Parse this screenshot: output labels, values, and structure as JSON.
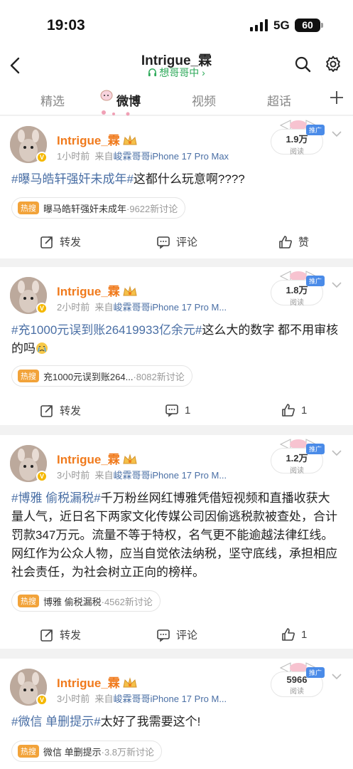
{
  "status": {
    "time": "19:03",
    "network": "5G",
    "battery": "60"
  },
  "header": {
    "title": "Intrigue_霖",
    "subtitle": "想哥哥中",
    "subtitle_arrow": "›"
  },
  "tabs": [
    {
      "label": "精选"
    },
    {
      "label": "微博"
    },
    {
      "label": "视频"
    },
    {
      "label": "超话"
    }
  ],
  "posts": [
    {
      "author": "Intrigue_霖",
      "time": "1小时前",
      "from_prefix": "来自",
      "source": "峻霖哥哥iPhone 17 Pro Max",
      "promo": "推广",
      "reads": "1.9万",
      "reads_label": "阅读",
      "tag": "#曝马皓轩强奸未成年#",
      "text": "这都什么玩意啊????",
      "hot_label": "热搜",
      "hot_topic": "曝马皓轩强奸未成年",
      "hot_count": "·9622新讨论",
      "repost": "转发",
      "comment": "评论",
      "like": "赞"
    },
    {
      "author": "Intrigue_霖",
      "time": "2小时前",
      "from_prefix": "来自",
      "source": "峻霖哥哥iPhone 17 Pro M...",
      "promo": "推广",
      "reads": "1.8万",
      "reads_label": "阅读",
      "tag": "#充1000元误到账26419933亿余元#",
      "text": "这么大的数字 都不用审核的吗",
      "hot_label": "热搜",
      "hot_topic": "充1000元误到账264...",
      "hot_count": "·8082新讨论",
      "repost": "转发",
      "comment": "1",
      "like": "1"
    },
    {
      "author": "Intrigue_霖",
      "time": "3小时前",
      "from_prefix": "来自",
      "source": "峻霖哥哥iPhone 17 Pro M...",
      "promo": "推广",
      "reads": "1.2万",
      "reads_label": "阅读",
      "tag": "#博雅 偷税漏税#",
      "text": "千万粉丝网红博雅凭借短视频和直播收获大量人气，近日名下两家文化传媒公司因偷逃税款被查处，合计罚款347万元。流量不等于特权，名气更不能逾越法律红线。网红作为公众人物，应当自觉依法纳税，坚守底线，承担相应社会责任，为社会树立正向的榜样。",
      "hot_label": "热搜",
      "hot_topic": "博雅 偷税漏税",
      "hot_count": "·4562新讨论",
      "repost": "转发",
      "comment": "评论",
      "like": "1"
    },
    {
      "author": "Intrigue_霖",
      "time": "3小时前",
      "from_prefix": "来自",
      "source": "峻霖哥哥iPhone 17 Pro M...",
      "promo": "推广",
      "reads": "5966",
      "reads_label": "阅读",
      "tag": "#微信 单删提示#",
      "text": "太好了我需要这个!",
      "hot_label": "热搜",
      "hot_topic": "微信 单删提示",
      "hot_count": "·3.8万新讨论"
    }
  ],
  "colors": {
    "author": "#f07a1c",
    "tag": "#4a6fa5",
    "hot": "#f2a33a",
    "subtitle": "#2eaa5a"
  },
  "icons": [
    "back-icon",
    "search-icon",
    "gear-icon",
    "plus-icon",
    "repost-icon",
    "comment-icon",
    "like-icon",
    "chevron-down-icon",
    "crown-icon",
    "headset-icon"
  ]
}
